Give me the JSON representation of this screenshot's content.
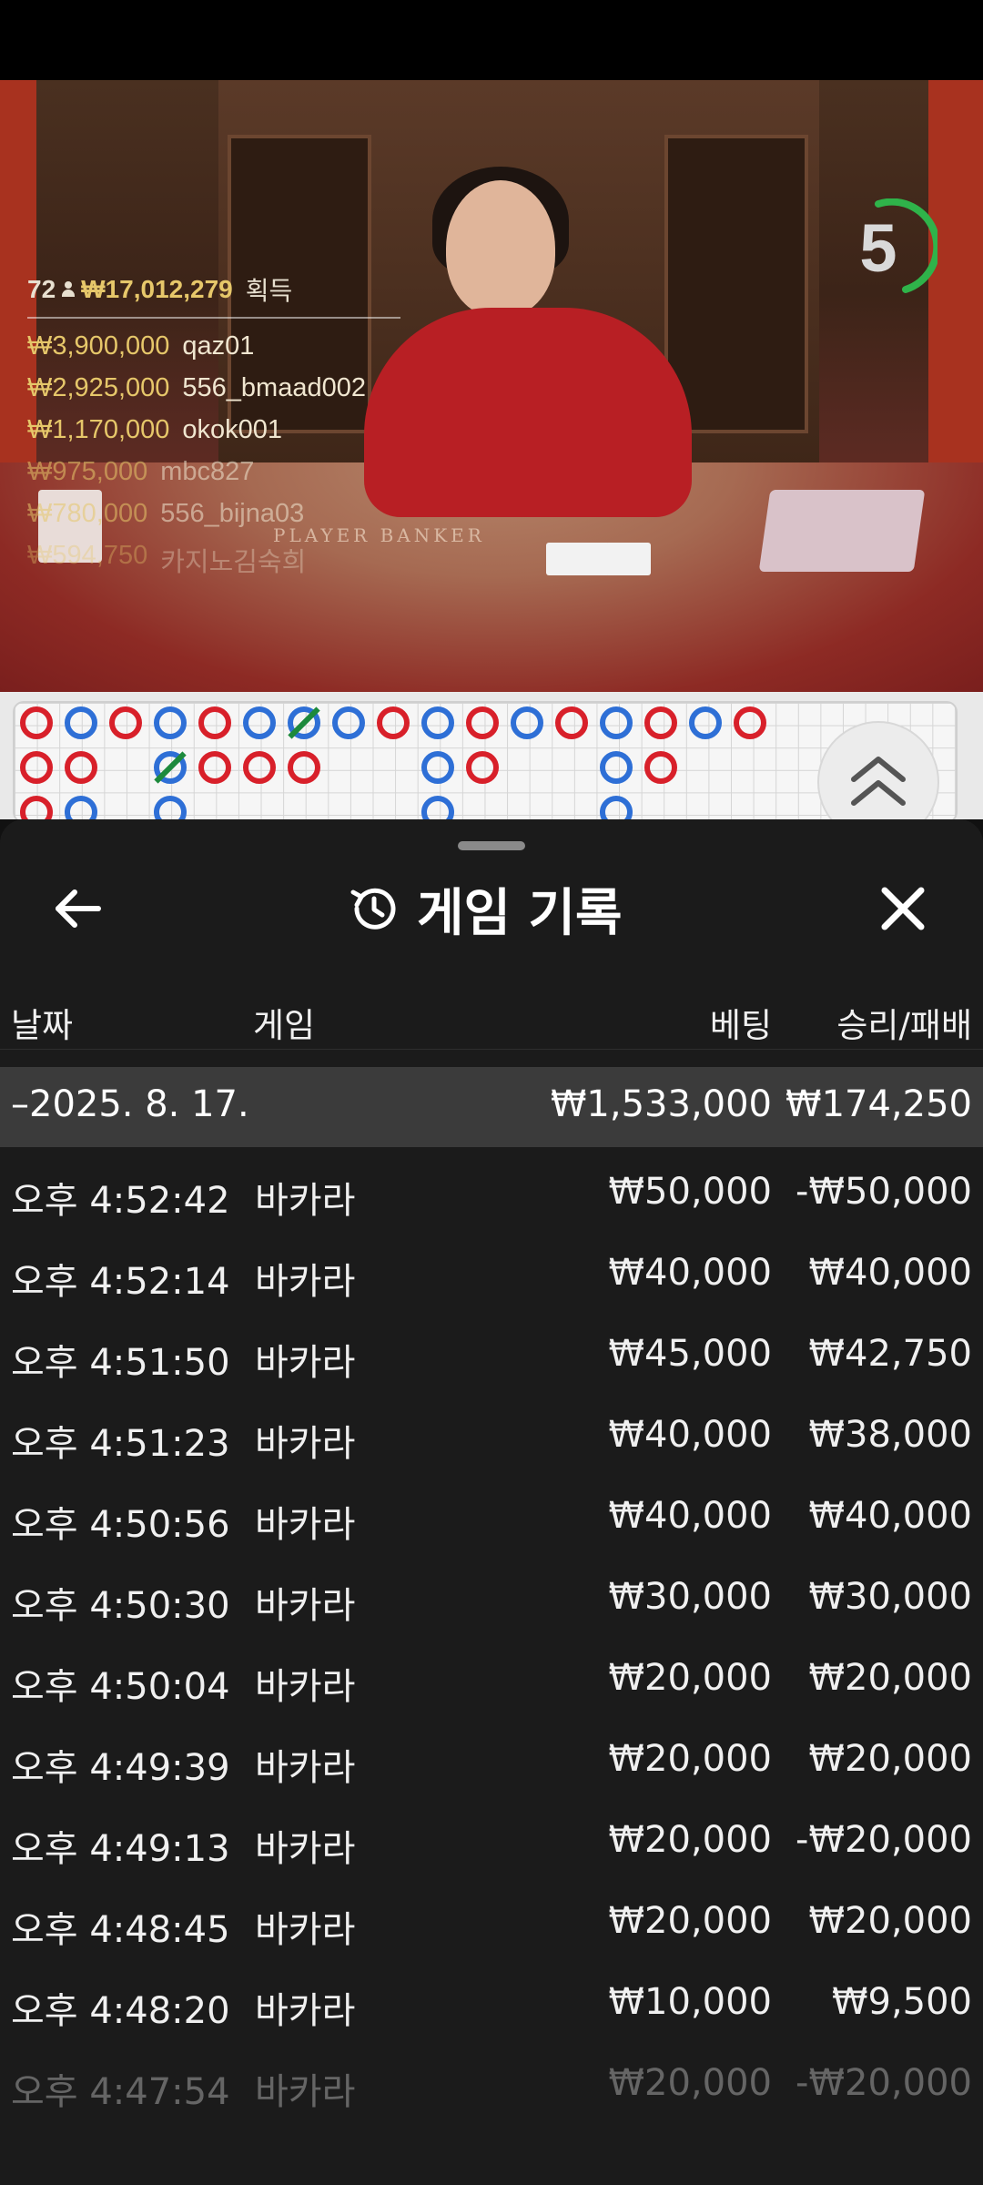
{
  "video": {
    "table_label": "PLAYER      BANKER",
    "winners": {
      "count": "72",
      "total": "₩17,012,279",
      "suffix": "획득",
      "rows": [
        {
          "amount": "₩3,900,000",
          "name": "qaz01"
        },
        {
          "amount": "₩2,925,000",
          "name": "556_bmaad002"
        },
        {
          "amount": "₩1,170,000",
          "name": "okok001"
        },
        {
          "amount": "₩975,000",
          "name": "mbc827"
        },
        {
          "amount": "₩780,000",
          "name": "556_bijna03"
        },
        {
          "amount": "₩594,750",
          "name": "카지노김숙희"
        }
      ]
    },
    "timer": {
      "value": "5",
      "accent": "#2fb34a"
    }
  },
  "colors": {
    "banker": "#d8202a",
    "player": "#2e6fd6",
    "tie": "#1d8a3c"
  },
  "sheet": {
    "title": "게임 기록",
    "columns": {
      "date": "날짜",
      "game": "게임",
      "bet": "베팅",
      "result": "승리/패배"
    },
    "date_group": {
      "date": "–2025. 8. 17.",
      "bet": "₩1,533,000",
      "result": "₩174,250"
    },
    "rows": [
      {
        "time": "오후 4:52:42",
        "game": "바카라",
        "bet": "₩50,000",
        "result": "-₩50,000"
      },
      {
        "time": "오후 4:52:14",
        "game": "바카라",
        "bet": "₩40,000",
        "result": "₩40,000"
      },
      {
        "time": "오후 4:51:50",
        "game": "바카라",
        "bet": "₩45,000",
        "result": "₩42,750"
      },
      {
        "time": "오후 4:51:23",
        "game": "바카라",
        "bet": "₩40,000",
        "result": "₩38,000"
      },
      {
        "time": "오후 4:50:56",
        "game": "바카라",
        "bet": "₩40,000",
        "result": "₩40,000"
      },
      {
        "time": "오후 4:50:30",
        "game": "바카라",
        "bet": "₩30,000",
        "result": "₩30,000"
      },
      {
        "time": "오후 4:50:04",
        "game": "바카라",
        "bet": "₩20,000",
        "result": "₩20,000"
      },
      {
        "time": "오후 4:49:39",
        "game": "바카라",
        "bet": "₩20,000",
        "result": "₩20,000"
      },
      {
        "time": "오후 4:49:13",
        "game": "바카라",
        "bet": "₩20,000",
        "result": "-₩20,000"
      },
      {
        "time": "오후 4:48:45",
        "game": "바카라",
        "bet": "₩20,000",
        "result": "₩20,000"
      },
      {
        "time": "오후 4:48:20",
        "game": "바카라",
        "bet": "₩10,000",
        "result": "₩9,500"
      },
      {
        "time": "오후 4:47:54",
        "game": "바카라",
        "bet": "₩20,000",
        "result": "-₩20,000"
      }
    ]
  },
  "icons": {
    "back": "arrow-left-icon",
    "history": "history-icon",
    "close": "close-icon",
    "expand": "chevron-double-up-icon",
    "players": "person-icon"
  }
}
